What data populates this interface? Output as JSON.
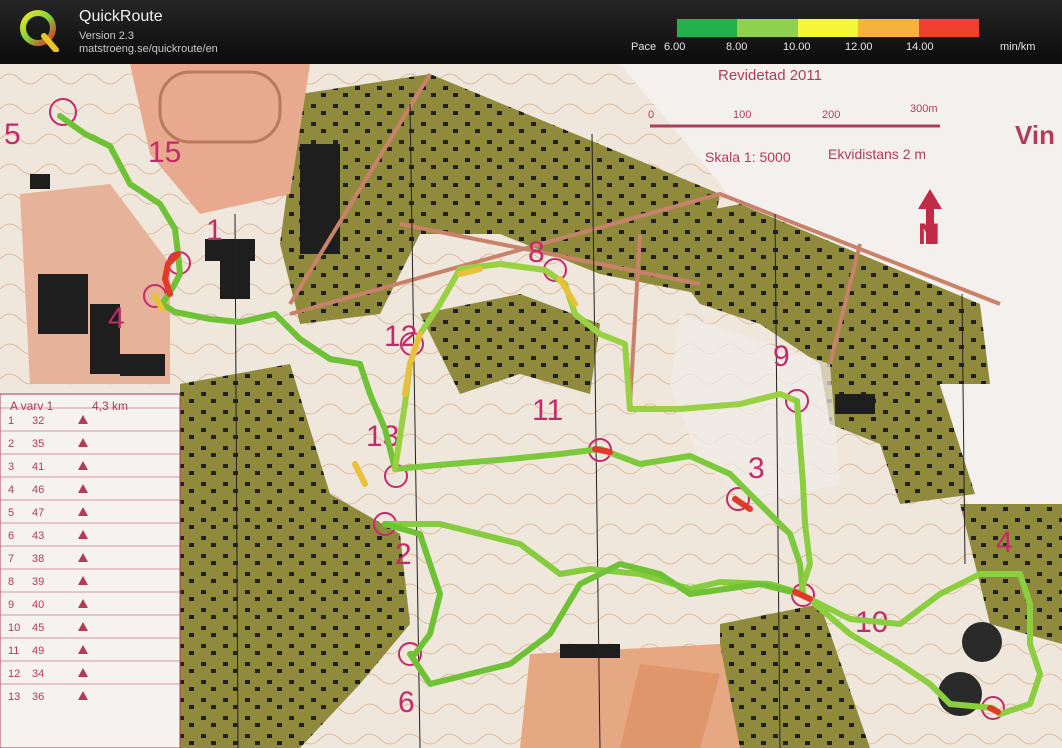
{
  "app": {
    "title": "QuickRoute",
    "version": "Version 2.3",
    "url": "matstroeng.se/quickroute/en"
  },
  "legend": {
    "label": "Pace",
    "unit": "min/km",
    "ticks": [
      "6.00",
      "8.00",
      "10.00",
      "12.00",
      "14.00"
    ],
    "colors": [
      "#22b14c",
      "#8fd14f",
      "#f5f53a",
      "#f7b23b",
      "#f04030"
    ]
  },
  "map": {
    "revision": "Revidetad 2011",
    "scale_numbers": [
      "0",
      "100",
      "200",
      "300m"
    ],
    "scale": "Skala 1: 5000",
    "contour": "Ekvidistans 2 m",
    "north": "N",
    "partial_title": "Vin",
    "course": "A varv 1",
    "length": "4,3 km",
    "control_numbers": [
      "15",
      "1",
      "4",
      "12",
      "8",
      "13",
      "11",
      "9",
      "3",
      "2",
      "10",
      "4",
      "6",
      "5"
    ],
    "description_rows": [
      {
        "n": "1",
        "code": "32"
      },
      {
        "n": "2",
        "code": "35"
      },
      {
        "n": "3",
        "code": "41"
      },
      {
        "n": "4",
        "code": "46"
      },
      {
        "n": "5",
        "code": "47"
      },
      {
        "n": "6",
        "code": "43"
      },
      {
        "n": "7",
        "code": "38"
      },
      {
        "n": "8",
        "code": "39"
      },
      {
        "n": "9",
        "code": "40"
      },
      {
        "n": "10",
        "code": "45"
      },
      {
        "n": "11",
        "code": "49"
      },
      {
        "n": "12",
        "code": "34"
      },
      {
        "n": "13",
        "code": "36"
      }
    ],
    "description_sizes": [
      "3.0",
      "1.0",
      "1.0",
      "1.0",
      "1.0",
      "1.2",
      "0.8"
    ]
  }
}
